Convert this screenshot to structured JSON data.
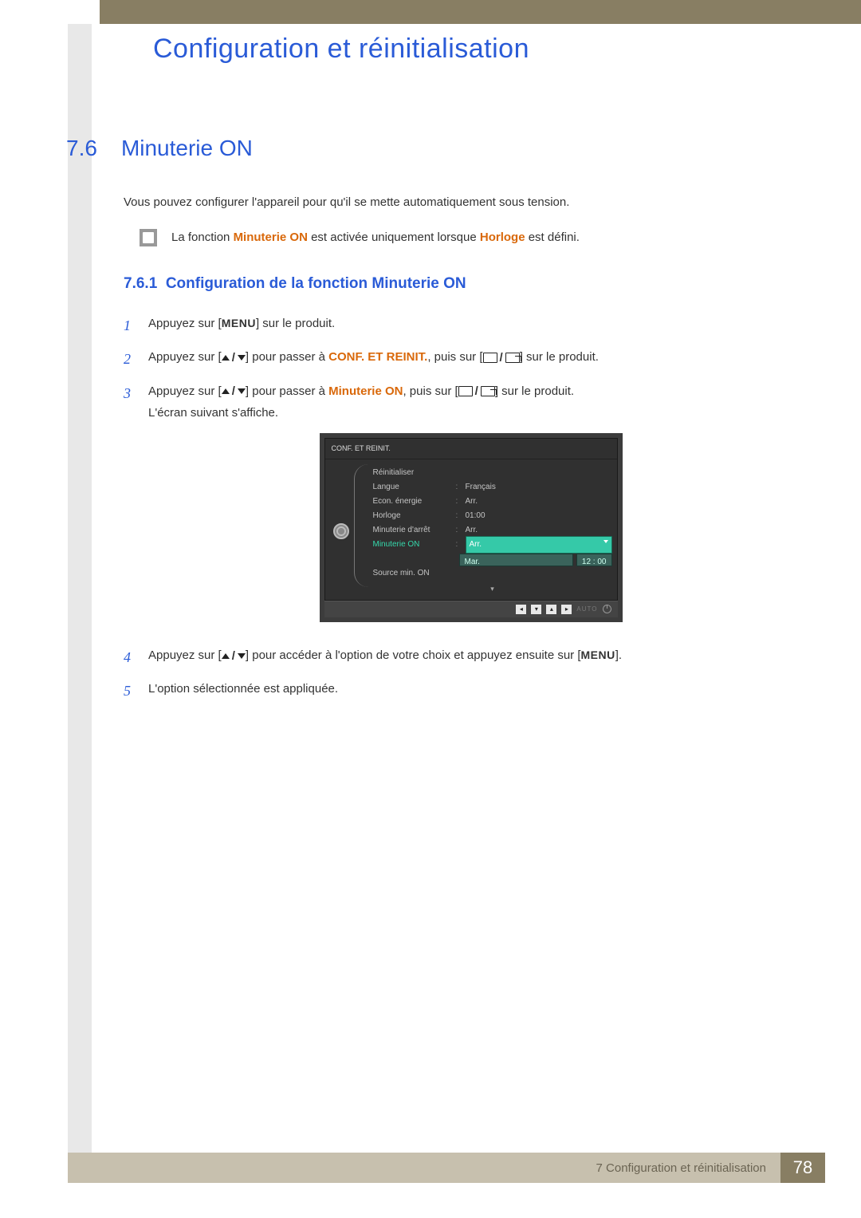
{
  "chapter_title": "Configuration et réinitialisation",
  "section": {
    "number": "7.6",
    "title": "Minuterie ON",
    "intro": "Vous pouvez configurer l'appareil pour qu'il se mette automatiquement sous tension.",
    "note_pre": "La fonction ",
    "note_hl1": "Minuterie ON",
    "note_mid": " est activée uniquement lorsque ",
    "note_hl2": "Horloge",
    "note_post": " est défini."
  },
  "subsection": {
    "number": "7.6.1",
    "title": "Configuration de la fonction Minuterie ON"
  },
  "steps": {
    "s1": {
      "pre": "Appuyez sur [",
      "menu": "MENU",
      "post": "] sur le produit."
    },
    "s2": {
      "pre": "Appuyez sur [",
      "mid1": "] pour passer à ",
      "hl": "CONF. ET REINIT.",
      "mid2": ", puis sur [",
      "post": "] sur le produit."
    },
    "s3": {
      "pre": "Appuyez sur [",
      "mid1": "] pour passer à ",
      "hl": "Minuterie ON",
      "mid2": ", puis sur [",
      "post": "] sur le produit.",
      "line2": "L'écran suivant s'affiche."
    },
    "s4": {
      "pre": "Appuyez sur [",
      "mid": "] pour accéder à l'option de votre choix et appuyez ensuite sur [",
      "menu": "MENU",
      "post": "]."
    },
    "s5": {
      "text": "L'option sélectionnée est appliquée."
    }
  },
  "osd": {
    "title": "CONF. ET REINIT.",
    "rows": {
      "reset": "Réinitialiser",
      "langue": "Langue",
      "langue_val": "Français",
      "econ": "Econ. énergie",
      "econ_val": "Arr.",
      "horloge": "Horloge",
      "horloge_val": "01:00",
      "min_arret": "Minuterie d'arrêt",
      "min_arret_val": "Arr.",
      "min_on": "Minuterie ON",
      "min_on_val": "Arr.",
      "src": "Source min. ON",
      "sub_day": "Mar.",
      "sub_time": "12 : 00"
    },
    "foot_auto": "AUTO"
  },
  "footer": {
    "label": "7 Configuration et réinitialisation",
    "page": "78"
  }
}
